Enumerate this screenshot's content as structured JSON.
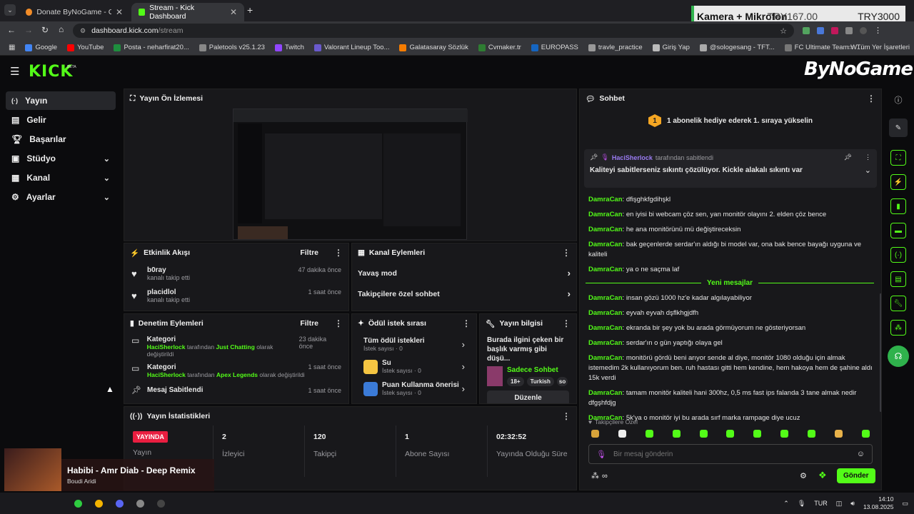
{
  "browser": {
    "tabs": [
      {
        "title": "Donate ByNoGame - Gelen/Gid",
        "active": false
      },
      {
        "title": "Stream - Kick Dashboard",
        "active": true
      }
    ],
    "url_host": "dashboard.kick.com",
    "url_path": "/stream",
    "bookmarks": [
      "Google",
      "YouTube",
      "Posta - neharfirat20...",
      "Paletools v25.1.23",
      "Twitch",
      "Valorant Lineup Too...",
      "Galatasaray Sözlük",
      "Cvmaker.tr",
      "EUROPASS",
      "travle_practice",
      "Giriş Yap",
      "@sologesang - TFT...",
      "FC Ultimate Team W..."
    ],
    "bookmarks_right": "Tüm Yer İşaretleri"
  },
  "overlay": {
    "camera_label": "Kamera + Mikrofon",
    "camera_price": "TRY167.00",
    "goal_price": "TRY3000",
    "bynogame": "ByNoGame"
  },
  "brand": {
    "logo": "KICK",
    "beta": "BETA"
  },
  "sidebar": {
    "items": [
      {
        "label": "Yayın",
        "active": true
      },
      {
        "label": "Gelir"
      },
      {
        "label": "Başarılar"
      },
      {
        "label": "Stüdyo"
      },
      {
        "label": "Kanal"
      },
      {
        "label": "Ayarlar"
      }
    ]
  },
  "preview": {
    "title": "Yayın Ön İzlemesi"
  },
  "activity": {
    "title": "Etkinlik Akışı",
    "filter": "Filtre",
    "events": [
      {
        "user": "b0ray",
        "desc": "kanalı takip etti",
        "time": "47 dakika önce"
      },
      {
        "user": "placidlol",
        "desc": "kanalı takip etti",
        "time": "1 saat önce"
      }
    ]
  },
  "channel_actions": {
    "title": "Kanal Eylemleri",
    "items": [
      "Yavaş mod",
      "Takipçilere özel sohbet"
    ]
  },
  "moderation": {
    "title": "Denetim Eylemleri",
    "filter": "Filtre",
    "items": [
      {
        "title": "Kategori",
        "by": "HaciSherlock",
        "mid": "tarafından",
        "target": "Just Chatting",
        "end": "olarak değiştirildi",
        "time": "23 dakika önce"
      },
      {
        "title": "Kategori",
        "by": "HaciSherlock",
        "mid": "tarafından",
        "target": "Apex Legends",
        "end": "olarak değiştirildi",
        "time": "1 saat önce"
      },
      {
        "title": "Mesaj Sabitlendi",
        "time": "1 saat önce"
      }
    ]
  },
  "rewards": {
    "title": "Ödül istek sırası",
    "items": [
      {
        "title": "Tüm ödül istekleri",
        "sub": "İstek sayısı · 0"
      },
      {
        "title": "Su",
        "sub": "İstek sayısı · 0"
      },
      {
        "title": "Puan Kullanma önerisi",
        "sub": "İstek sayısı · 0"
      }
    ]
  },
  "stream_info": {
    "title": "Yayın bilgisi",
    "stream_title": "Burada ilgini çeken bir başlık varmış gibi düşü...",
    "category": "Sadece Sohbet",
    "tags": [
      "18+",
      "Turkish",
      "so"
    ],
    "edit": "Düzenle"
  },
  "stats": {
    "title": "Yayın İstatistikleri",
    "live_badge": "YAYINDA",
    "live_label": "Yayın",
    "items": [
      {
        "value": "2",
        "label": "İzleyici"
      },
      {
        "value": "120",
        "label": "Takipçi"
      },
      {
        "value": "1",
        "label": "Abone Sayısı"
      },
      {
        "value": "02:32:52",
        "label": "Yayında Olduğu Süre"
      }
    ]
  },
  "chat": {
    "title": "Sohbet",
    "sub_banner": "1 abonelik hediye ederek 1. sıraya yükselin",
    "sub_count": "1",
    "pinned_by": "HaciSherlock",
    "pinned_suffix": "tarafından sabitlendi",
    "pinned_msg": "Kaliteyi sabitlerseniz sıkıntı çözülüyor. Kickle alakalı sıkıntı var",
    "messages_before": [
      {
        "user": "DamraCan",
        "text": "dfişghkfgdihşkl"
      },
      {
        "user": "DamraCan",
        "text": "en iyisi bi webcam çöz sen, yan monitör olayını 2. elden çöz bence"
      },
      {
        "user": "DamraCan",
        "text": "he ana monitörünü mü değiştireceksin"
      },
      {
        "user": "DamraCan",
        "text": "bak geçenlerde serdar'ın aldığı bi model var, ona bak bence bayağı uyguna ve kaliteli"
      },
      {
        "user": "DamraCan",
        "text": "ya o ne saçma laf"
      }
    ],
    "new_messages": "Yeni mesajlar",
    "messages_after": [
      {
        "user": "DamraCan",
        "text": "insan gözü 1000 hz'e kadar algılayabiliyor"
      },
      {
        "user": "DamraCan",
        "text": "eyvah eyvah dşflkhgjdfh"
      },
      {
        "user": "DamraCan",
        "text": "ekranda bir şey yok bu arada görmüyorum ne gösteriyorsan"
      },
      {
        "user": "DamraCan",
        "text": "serdar'ın o gün yaptığı olaya gel"
      },
      {
        "user": "DamraCan",
        "text": "monitörü gördü beni arıyor sende al diye, monitör 1080 olduğu için almak istemedim 2k kullanıyorum ben. ruh hastası gitti hem kendine, hem hakoya hem de şahine aldı 15k verdi"
      },
      {
        "user": "DamraCan",
        "text": "tamam monitör kaliteli hani 300hz, 0,5 ms fast ips falanda 3 tane almak nedir dfgşhfdjg"
      },
      {
        "user": "DamraCan",
        "text": "5k'ya o monitör iyi bu arada sırf marka rampage diye ucuz"
      }
    ],
    "followers_only": "Takipçilere Özel",
    "placeholder": "Bir mesaj gönderin",
    "send": "Gönder",
    "colors": {
      "accent": "#53fc18"
    }
  },
  "music": {
    "title": "Habibi - Amr Diab - Deep Remix",
    "artist": "Boudi Aridi"
  },
  "taskbar": {
    "lang": "TUR",
    "time": "14:10",
    "date": "13.08.2025"
  }
}
